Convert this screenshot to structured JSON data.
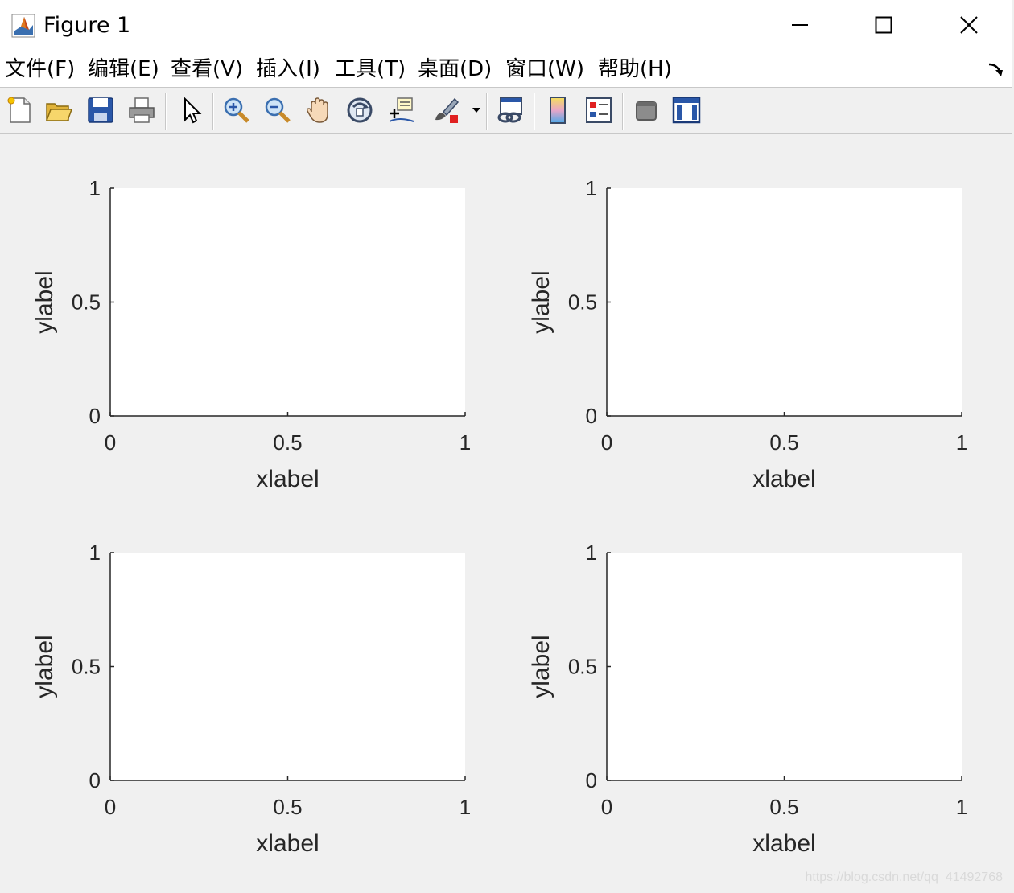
{
  "window": {
    "title": "Figure 1"
  },
  "menu": [
    {
      "label": "文件(F)"
    },
    {
      "label": "编辑(E)"
    },
    {
      "label": "查看(V)"
    },
    {
      "label": "插入(I)"
    },
    {
      "label": "工具(T)"
    },
    {
      "label": "桌面(D)"
    },
    {
      "label": "窗口(W)"
    },
    {
      "label": "帮助(H)"
    }
  ],
  "toolbar": {
    "icons": [
      "new-figure-icon",
      "open-file-icon",
      "save-icon",
      "print-icon",
      "select-pointer-icon",
      "zoom-in-icon",
      "zoom-out-icon",
      "pan-hand-icon",
      "rotate-3d-icon",
      "data-cursor-icon",
      "brush-icon",
      "link-plot-icon",
      "colorbar-icon",
      "legend-icon",
      "hide-plot-tools-icon",
      "show-plot-tools-icon"
    ]
  },
  "chart_data": [
    {
      "type": "line",
      "xlabel": "xlabel",
      "ylabel": "ylabel",
      "xlim": [
        0,
        1
      ],
      "ylim": [
        0,
        1
      ],
      "xticks": [
        "0",
        "0.5",
        "1"
      ],
      "yticks": [
        "0",
        "0.5",
        "1"
      ],
      "series": []
    },
    {
      "type": "line",
      "xlabel": "xlabel",
      "ylabel": "ylabel",
      "xlim": [
        0,
        1
      ],
      "ylim": [
        0,
        1
      ],
      "xticks": [
        "0",
        "0.5",
        "1"
      ],
      "yticks": [
        "0",
        "0.5",
        "1"
      ],
      "series": []
    },
    {
      "type": "line",
      "xlabel": "xlabel",
      "ylabel": "ylabel",
      "xlim": [
        0,
        1
      ],
      "ylim": [
        0,
        1
      ],
      "xticks": [
        "0",
        "0.5",
        "1"
      ],
      "yticks": [
        "0",
        "0.5",
        "1"
      ],
      "series": []
    },
    {
      "type": "line",
      "xlabel": "xlabel",
      "ylabel": "ylabel",
      "xlim": [
        0,
        1
      ],
      "ylim": [
        0,
        1
      ],
      "xticks": [
        "0",
        "0.5",
        "1"
      ],
      "yticks": [
        "0",
        "0.5",
        "1"
      ],
      "series": []
    }
  ],
  "watermark": "https://blog.csdn.net/qq_41492768",
  "colors": {
    "axes_background": "#ffffff",
    "figure_background": "#f0f0f0",
    "axis_color": "#262626"
  }
}
